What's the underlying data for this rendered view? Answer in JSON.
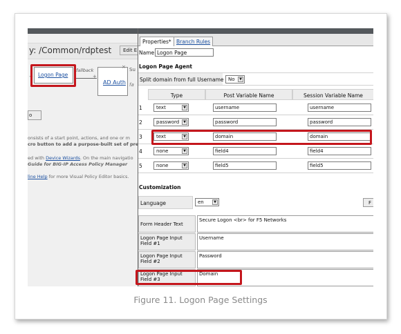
{
  "background": {
    "title": "y: /Common/rdptest",
    "edit_label": "Edit E",
    "flow": {
      "logon_node": "Logon Page",
      "fallback": "fallback",
      "ad_node": "AD Auth",
      "suffix_1": "Su",
      "suffix_2": "fa"
    },
    "small_button": "o",
    "paragraph_lines": [
      "onsists of a start point, actions, and one or m",
      "cro button to add a purpose-built set of prede"
    ],
    "help_line_1": {
      "prefix": "ed with ",
      "link": "Device Wizards",
      "suffix": ". On the main navigatio"
    },
    "help_line_2": "Guide for BIG-IP Access Policy Manager",
    "help_line_3": {
      "link": "line Help",
      "suffix": " for more Visual Policy Editor basics."
    }
  },
  "panel": {
    "tabs": [
      {
        "label": "Properties*"
      },
      {
        "label": "Branch Rules"
      }
    ],
    "name_label": "Name:",
    "name_value": "Logon Page",
    "section_agent": "Logon Page Agent",
    "split_label": "Split domain from full Username",
    "split_value": "No",
    "columns": [
      "Type",
      "Post Variable Name",
      "Session Variable Name"
    ],
    "rows": [
      {
        "num": "1",
        "type": "text",
        "post": "username",
        "session": "username"
      },
      {
        "num": "2",
        "type": "password",
        "post": "password",
        "session": "password"
      },
      {
        "num": "3",
        "type": "text",
        "post": "domain",
        "session": "domain"
      },
      {
        "num": "4",
        "type": "none",
        "post": "field4",
        "session": "field4"
      },
      {
        "num": "5",
        "type": "none",
        "post": "field5",
        "session": "field5"
      }
    ],
    "section_custom": "Customization",
    "language_label": "Language",
    "language_value": "en",
    "language_btn": "F",
    "form_fields": [
      {
        "label": "Form Header Text",
        "value": "Secure Logon <br> for F5 Networks"
      },
      {
        "label": "Logon Page Input Field #1",
        "value": "Username"
      },
      {
        "label": "Logon Page Input Field #2",
        "value": "Password"
      },
      {
        "label": "Logon Page Input Field #3",
        "value": "Domain"
      }
    ]
  },
  "caption": "Figure 11. Logon Page Settings"
}
